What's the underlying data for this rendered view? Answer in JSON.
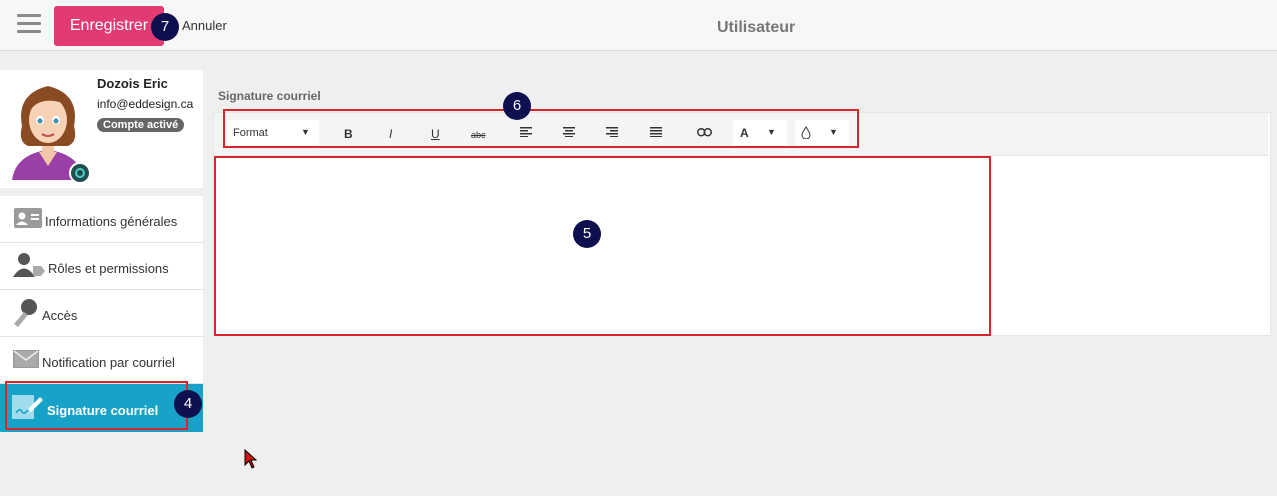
{
  "header": {
    "save_label": "Enregistrer",
    "cancel_label": "Annuler",
    "title": "Utilisateur"
  },
  "user": {
    "name": "Dozois Eric",
    "email": "info@eddesign.ca",
    "status": "Compte activé"
  },
  "sidebar": {
    "items": [
      {
        "label": "Informations générales",
        "icon": "id-card-icon"
      },
      {
        "label": "Rôles et permissions",
        "icon": "user-tag-icon"
      },
      {
        "label": "Accès",
        "icon": "key-icon"
      },
      {
        "label": "Notification par courriel",
        "icon": "envelope-icon"
      },
      {
        "label": "Signature courriel",
        "icon": "signature-icon",
        "active": true
      }
    ]
  },
  "main": {
    "section_label": "Signature courriel",
    "toolbar": {
      "format_label": "Format",
      "bold": "B",
      "italic": "I",
      "underline": "U",
      "strike": "abc",
      "font_color": "A"
    }
  },
  "markers": [
    "7",
    "4",
    "5",
    "6"
  ],
  "colors": {
    "accent": "#e23b72",
    "active": "#17a2c8",
    "marker": "#0d0f4f",
    "annotation": "#d9262b"
  }
}
